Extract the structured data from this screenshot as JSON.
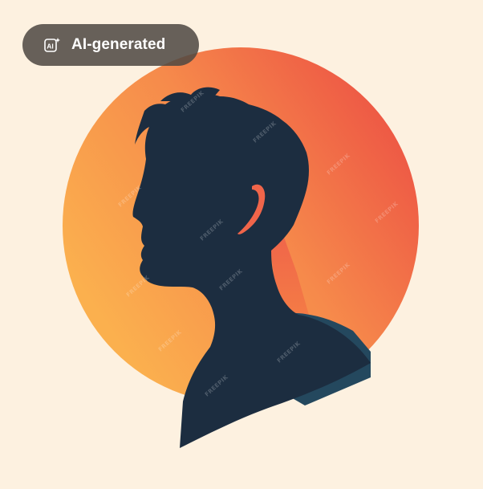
{
  "badge": {
    "label": "AI-generated",
    "icon": "ai-sparkle-icon"
  },
  "watermark": {
    "text": "FREEPIK"
  },
  "colors": {
    "background": "#fdf1e0",
    "sun_warm": "#fbb04e",
    "sun_hot": "#ee5a45",
    "silhouette": "#1c2d40",
    "shoulder_shadow": "#24485e",
    "ear_accent": "#f0654a",
    "badge_bg": "#4e4842"
  },
  "subject": "profile-silhouette-with-sun-circle"
}
